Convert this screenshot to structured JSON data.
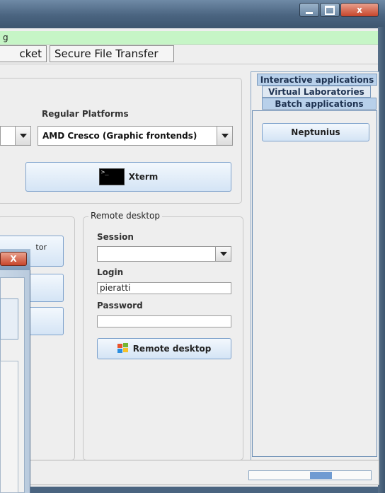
{
  "window": {
    "controls": {
      "minimize": "",
      "maximize": "",
      "close": "x"
    },
    "green_bar_text": "g"
  },
  "tabs": [
    {
      "label": "cket"
    },
    {
      "label": "Secure File Transfer"
    }
  ],
  "platforms": {
    "label": "Regular Platforms",
    "selected": "AMD Cresco (Graphic frontends)"
  },
  "xterm": {
    "label": "Xterm",
    "icon": "terminal-icon"
  },
  "left_buttons": {
    "first_fragment": "tor"
  },
  "remote_desktop": {
    "legend": "Remote desktop",
    "session_label": "Session",
    "session_value": "",
    "login_label": "Login",
    "login_value": "pieratti",
    "password_label": "Password",
    "password_value": "",
    "button_label": "Remote desktop",
    "button_icon": "windows-logo-icon"
  },
  "app_tabs": [
    {
      "label": "Interactive applications"
    },
    {
      "label": "Virtual Laboratories"
    },
    {
      "label": "Batch applications"
    }
  ],
  "batch": {
    "items": [
      {
        "label": "Neptunius"
      }
    ]
  },
  "progress": {
    "fraction": 0.18,
    "start": 0.5
  },
  "overlay_dialog": {
    "close": "X"
  },
  "colors": {
    "accent_blue": "#6f9bd2",
    "green_bar": "#c6f5c6",
    "close_red": "#c7452b"
  }
}
